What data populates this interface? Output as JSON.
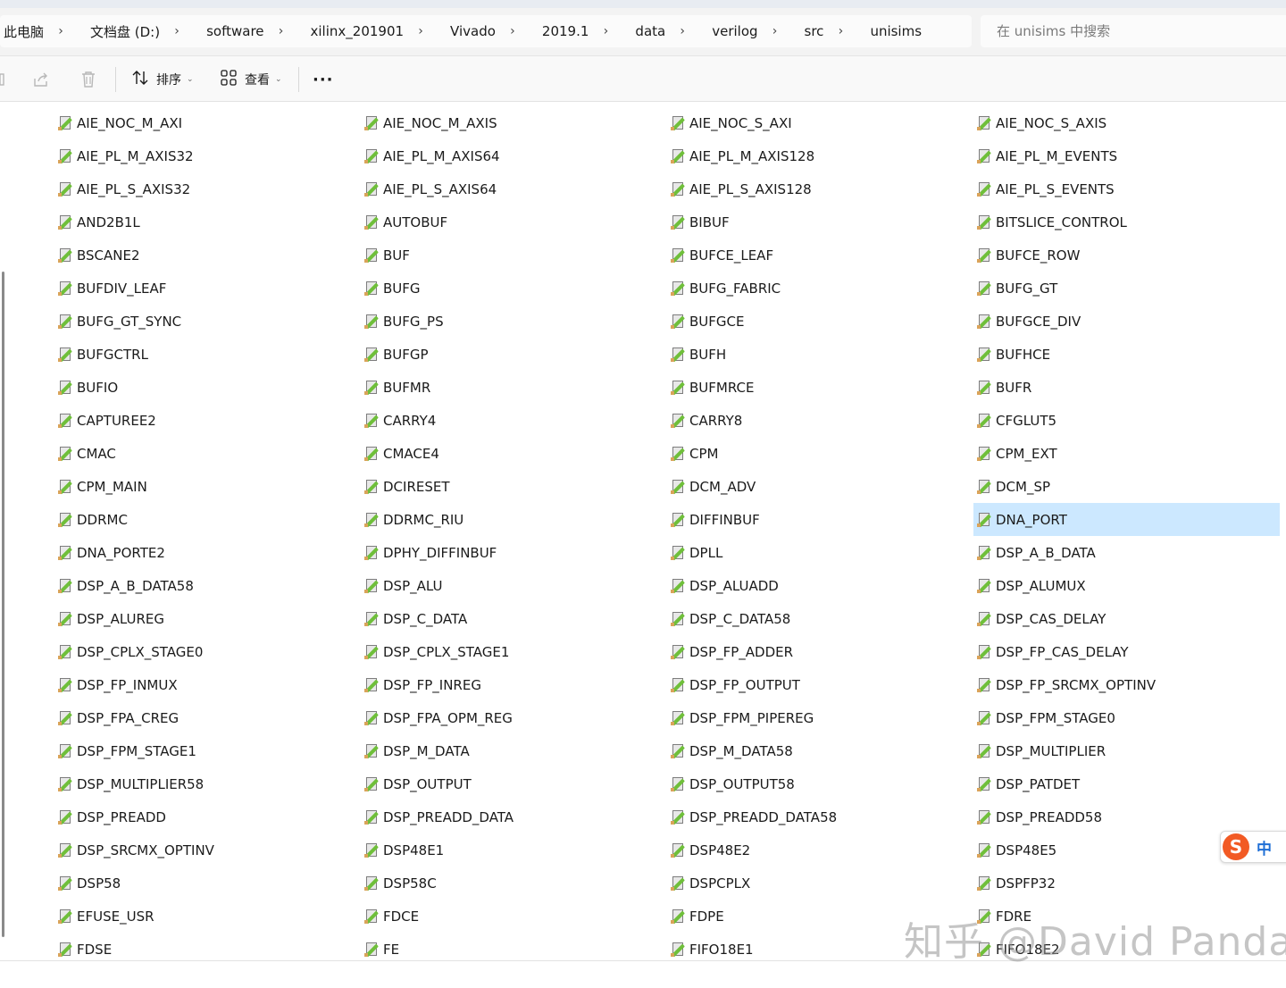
{
  "breadcrumb": [
    "此电脑",
    "文档盘 (D:)",
    "software",
    "xilinx_201901",
    "Vivado",
    "2019.1",
    "data",
    "verilog",
    "src",
    "unisims"
  ],
  "search": {
    "placeholder": "在 unisims 中搜索"
  },
  "toolbar": {
    "sort_label": "排序",
    "view_label": "查看",
    "more_label": "···"
  },
  "files": [
    "AIE_NOC_M_AXI",
    "AIE_NOC_M_AXIS",
    "AIE_NOC_S_AXI",
    "AIE_NOC_S_AXIS",
    "AIE_PL_M_AXIS32",
    "AIE_PL_M_AXIS64",
    "AIE_PL_M_AXIS128",
    "AIE_PL_M_EVENTS",
    "AIE_PL_S_AXIS32",
    "AIE_PL_S_AXIS64",
    "AIE_PL_S_AXIS128",
    "AIE_PL_S_EVENTS",
    "AND2B1L",
    "AUTOBUF",
    "BIBUF",
    "BITSLICE_CONTROL",
    "BSCANE2",
    "BUF",
    "BUFCE_LEAF",
    "BUFCE_ROW",
    "BUFDIV_LEAF",
    "BUFG",
    "BUFG_FABRIC",
    "BUFG_GT",
    "BUFG_GT_SYNC",
    "BUFG_PS",
    "BUFGCE",
    "BUFGCE_DIV",
    "BUFGCTRL",
    "BUFGP",
    "BUFH",
    "BUFHCE",
    "BUFIO",
    "BUFMR",
    "BUFMRCE",
    "BUFR",
    "CAPTUREE2",
    "CARRY4",
    "CARRY8",
    "CFGLUT5",
    "CMAC",
    "CMACE4",
    "CPM",
    "CPM_EXT",
    "CPM_MAIN",
    "DCIRESET",
    "DCM_ADV",
    "DCM_SP",
    "DDRMC",
    "DDRMC_RIU",
    "DIFFINBUF",
    "DNA_PORT",
    "DNA_PORTE2",
    "DPHY_DIFFINBUF",
    "DPLL",
    "DSP_A_B_DATA",
    "DSP_A_B_DATA58",
    "DSP_ALU",
    "DSP_ALUADD",
    "DSP_ALUMUX",
    "DSP_ALUREG",
    "DSP_C_DATA",
    "DSP_C_DATA58",
    "DSP_CAS_DELAY",
    "DSP_CPLX_STAGE0",
    "DSP_CPLX_STAGE1",
    "DSP_FP_ADDER",
    "DSP_FP_CAS_DELAY",
    "DSP_FP_INMUX",
    "DSP_FP_INREG",
    "DSP_FP_OUTPUT",
    "DSP_FP_SRCMX_OPTINV",
    "DSP_FPA_CREG",
    "DSP_FPA_OPM_REG",
    "DSP_FPM_PIPEREG",
    "DSP_FPM_STAGE0",
    "DSP_FPM_STAGE1",
    "DSP_M_DATA",
    "DSP_M_DATA58",
    "DSP_MULTIPLIER",
    "DSP_MULTIPLIER58",
    "DSP_OUTPUT",
    "DSP_OUTPUT58",
    "DSP_PATDET",
    "DSP_PREADD",
    "DSP_PREADD_DATA",
    "DSP_PREADD_DATA58",
    "DSP_PREADD58",
    "DSP_SRCMX_OPTINV",
    "DSP48E1",
    "DSP48E2",
    "DSP48E5",
    "DSP58",
    "DSP58C",
    "DSPCPLX",
    "DSPFP32",
    "EFUSE_USR",
    "FDCE",
    "FDPE",
    "FDRE",
    "FDSE",
    "FE",
    "FIFO18E1",
    "FIFO18E2"
  ],
  "selected_file": "DNA_PORT",
  "ime": {
    "logo": "S",
    "lang": "中"
  },
  "watermark": "知乎 @David Panda",
  "colors": {
    "selection": "#cce8ff",
    "icon_pen": "#6fbf3a",
    "ime_logo": "#f25a24",
    "ime_lang": "#1f6fd6"
  }
}
